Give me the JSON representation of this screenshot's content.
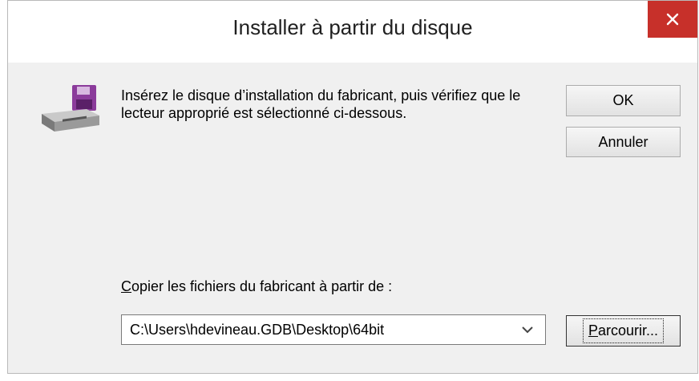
{
  "window": {
    "title": "Installer à partir du disque"
  },
  "message": "Insérez le disque d’installation du fabricant, puis vérifiez que le lecteur approprié est sélectionné ci-dessous.",
  "buttons": {
    "ok": "OK",
    "cancel": "Annuler",
    "browse_first": "P",
    "browse_rest": "arcourir..."
  },
  "copy_from": {
    "label_first": "C",
    "label_rest": "opier les fichiers du fabricant à partir de :",
    "value": "C:\\Users\\hdevineau.GDB\\Desktop\\64bit"
  },
  "icons": {
    "close": "close-icon",
    "disk": "install-disk-icon",
    "dropdown": "chevron-down-icon"
  },
  "colors": {
    "close_bg": "#c7302a",
    "dialog_bg": "#f0f0f0"
  }
}
